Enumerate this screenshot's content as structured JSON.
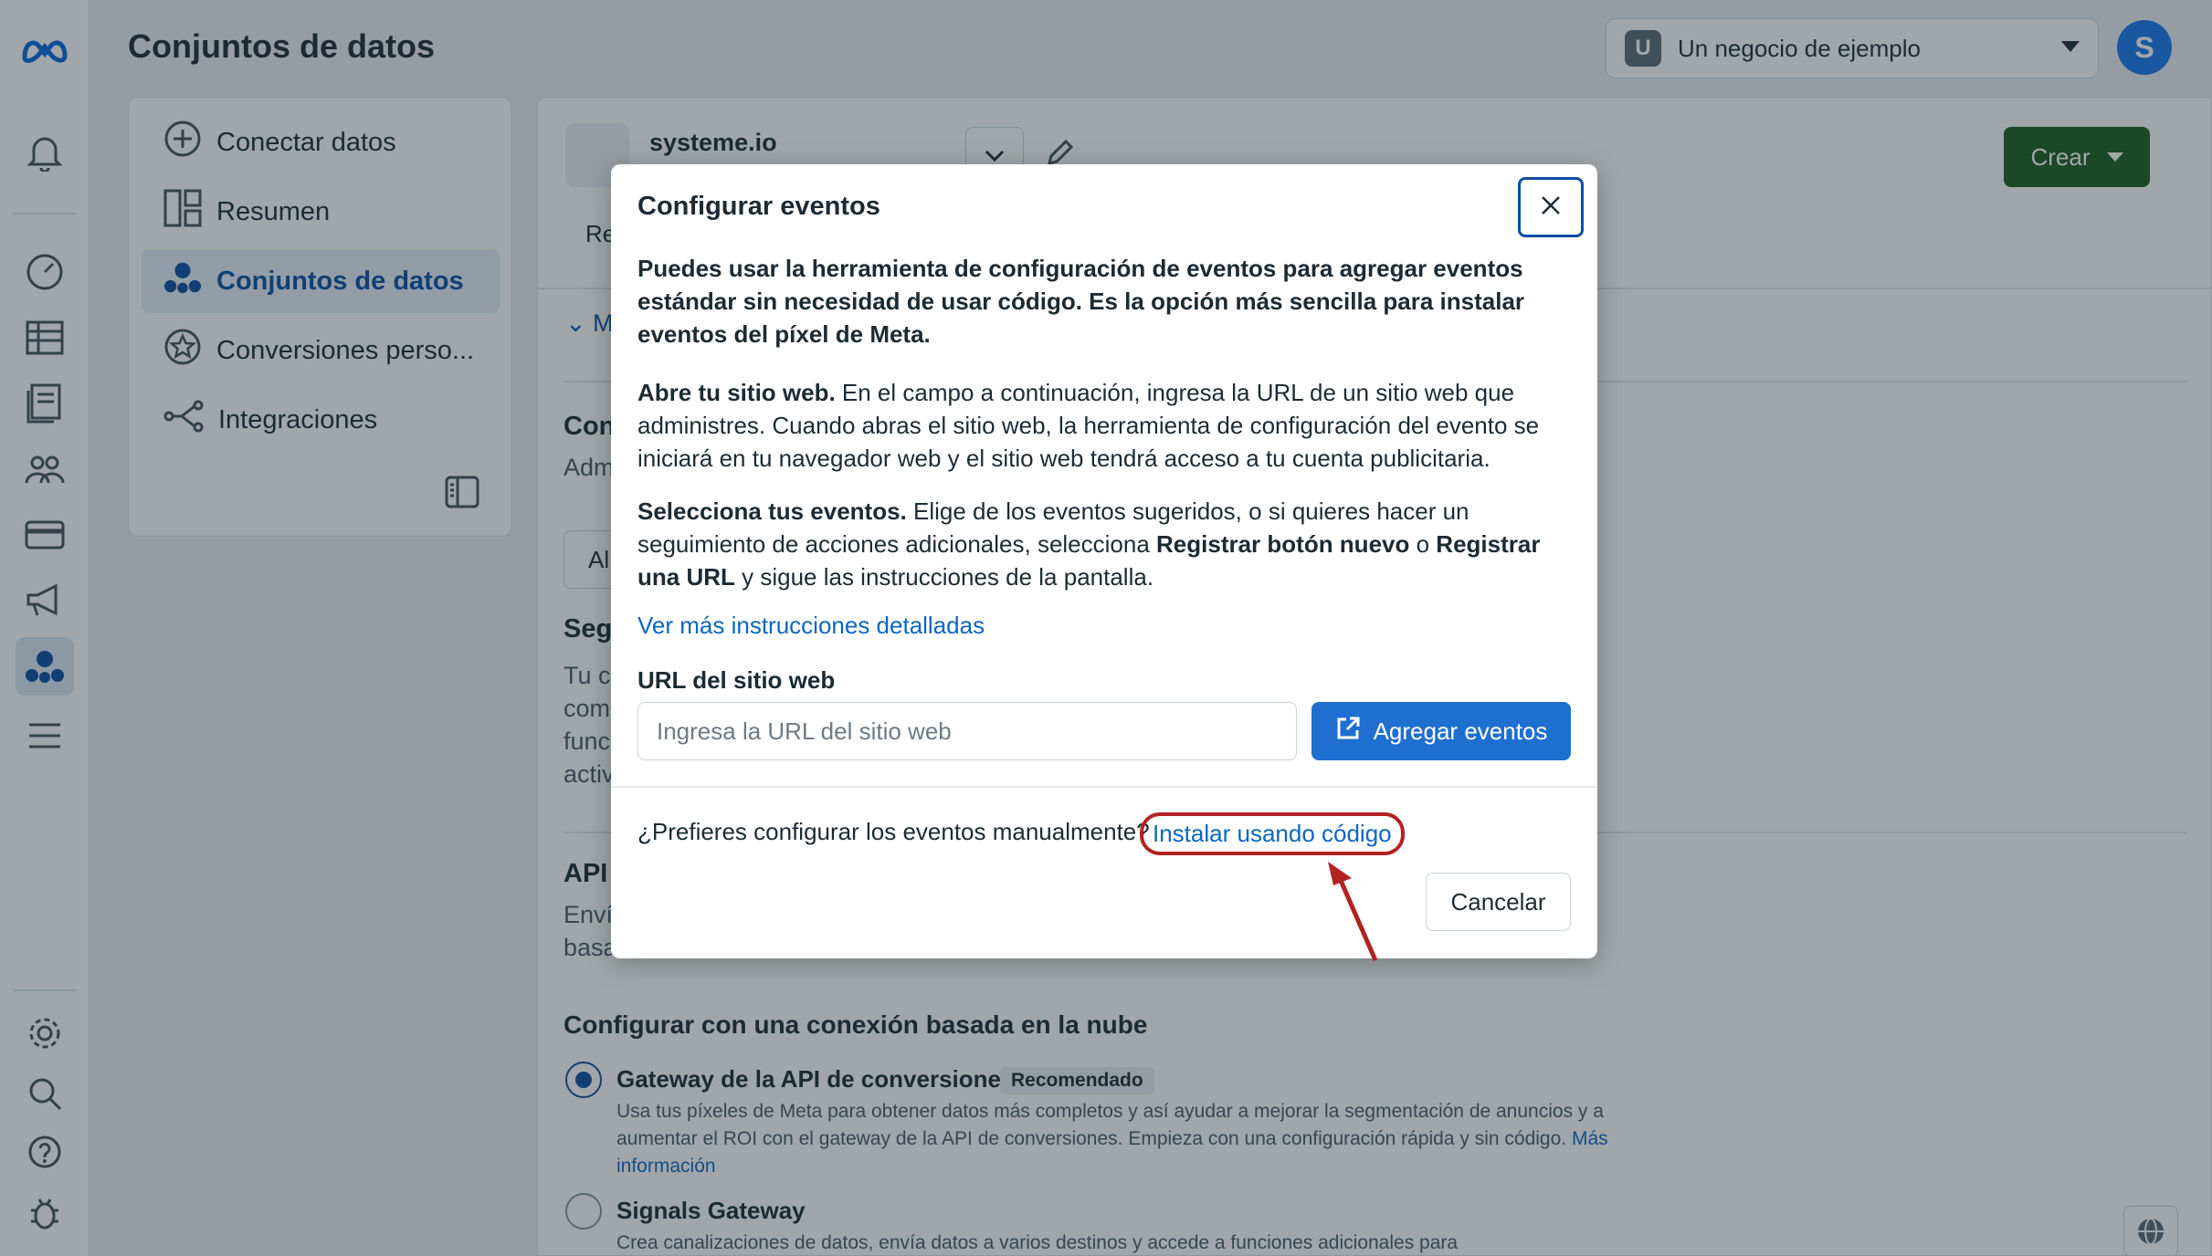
{
  "header": {
    "page_title": "Conjuntos de datos",
    "business_badge": "U",
    "business_name": "Un negocio de ejemplo",
    "profile_initial": "S"
  },
  "sidenav": {
    "items": [
      {
        "label": "Conectar datos",
        "icon": "plus-circle-icon"
      },
      {
        "label": "Resumen",
        "icon": "layout-icon"
      },
      {
        "label": "Conjuntos de datos",
        "icon": "datasets-icon",
        "active": true
      },
      {
        "label": "Conversiones perso...",
        "icon": "star-badge-icon"
      },
      {
        "label": "Integraciones",
        "icon": "integrations-icon"
      }
    ]
  },
  "main": {
    "dataset_name": "systeme.io",
    "create_button": "Crear",
    "tab_fragment": "Re",
    "expand_fragment": "M",
    "heading_fragment": "Con",
    "sub_fragment": "Adm",
    "button_fragment": "Al",
    "seg_fragment": "Seg",
    "para_fragments": [
      "Tu co",
      "com",
      "func",
      "activ"
    ],
    "api_fragment": "API",
    "api_desc_fragments": [
      "Enví",
      "basa"
    ],
    "cloud_section_title": "Configurar con una conexión basada en la nube",
    "options": [
      {
        "title": "Gateway de la API de conversiones",
        "badge": "Recomendado",
        "desc": "Usa tus píxeles de Meta para obtener datos más completos y así ayudar a mejorar la segmentación de anuncios y a aumentar el ROI con el gateway de la API de conversiones. Empieza con una configuración rápida y sin código.",
        "link": "Más información",
        "selected": true
      },
      {
        "title": "Signals Gateway",
        "desc": "Crea canalizaciones de datos, envía datos a varios destinos y accede a funciones adicionales para",
        "selected": false
      }
    ]
  },
  "modal": {
    "title": "Configurar eventos",
    "intro": "Puedes usar la herramienta de configuración de eventos para agregar eventos estándar sin necesidad de usar código. Es la opción más sencilla para instalar eventos del píxel de Meta.",
    "step1_bold": "Abre tu sitio web.",
    "step1_text": " En el campo a continuación, ingresa la URL de un sitio web que administres. Cuando abras el sitio web, la herramienta de configuración del evento se iniciará en tu navegador web y el sitio web tendrá acceso a tu cuenta publicitaria.",
    "step2_bold": "Selecciona tus eventos.",
    "step2_text_a": " Elige de los eventos sugeridos, o si quieres hacer un seguimiento de acciones adicionales, selecciona ",
    "step2_bold_b": "Registrar botón nuevo",
    "step2_text_c": " o ",
    "step2_bold_d": "Registrar una URL",
    "step2_text_e": " y sigue las instrucciones de la pantalla.",
    "more_link": "Ver más instrucciones detalladas",
    "url_label": "URL del sitio web",
    "url_placeholder": "Ingresa la URL del sitio web",
    "url_value": "",
    "add_button": "Agregar eventos",
    "manual_question": "¿Prefieres configurar los eventos manualmente?",
    "install_link": "Instalar usando código",
    "cancel_button": "Cancelar"
  },
  "colors": {
    "accent": "#1f6fd1",
    "link": "#0b66c3",
    "create_button": "#1b5e20",
    "highlight": "#b22222"
  }
}
